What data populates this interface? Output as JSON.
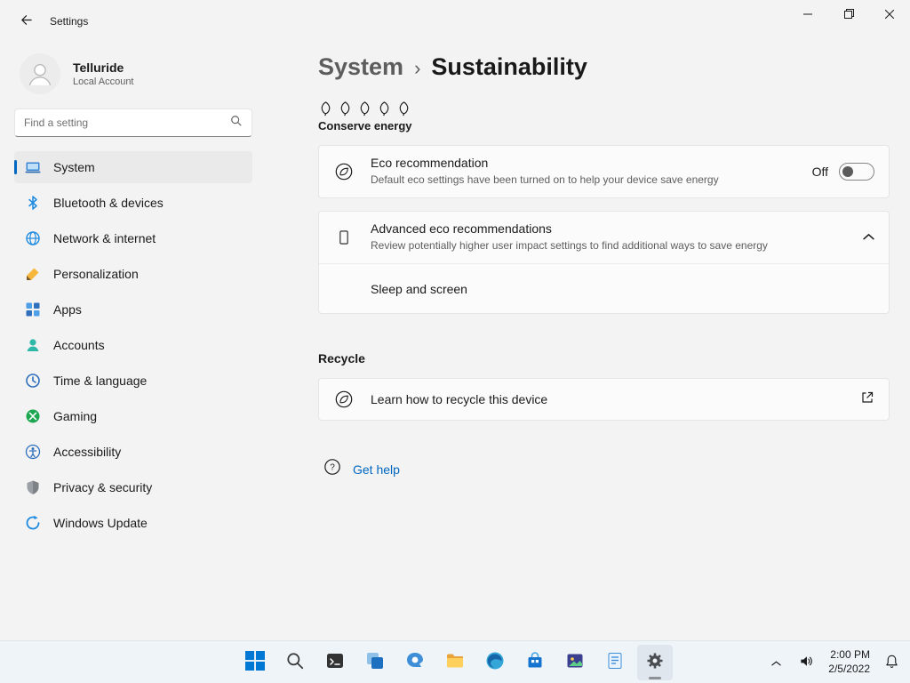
{
  "titlebar": {
    "title": "Settings"
  },
  "sidebar": {
    "user": {
      "name": "Telluride",
      "account_type": "Local Account"
    },
    "search_placeholder": "Find a setting",
    "items": [
      {
        "label": "System",
        "icon": "system-icon",
        "selected": true
      },
      {
        "label": "Bluetooth & devices",
        "icon": "bluetooth-icon",
        "selected": false
      },
      {
        "label": "Network & internet",
        "icon": "network-icon",
        "selected": false
      },
      {
        "label": "Personalization",
        "icon": "personalization-icon",
        "selected": false
      },
      {
        "label": "Apps",
        "icon": "apps-icon",
        "selected": false
      },
      {
        "label": "Accounts",
        "icon": "accounts-icon",
        "selected": false
      },
      {
        "label": "Time & language",
        "icon": "time-language-icon",
        "selected": false
      },
      {
        "label": "Gaming",
        "icon": "gaming-icon",
        "selected": false
      },
      {
        "label": "Accessibility",
        "icon": "accessibility-icon",
        "selected": false
      },
      {
        "label": "Privacy & security",
        "icon": "privacy-icon",
        "selected": false
      },
      {
        "label": "Windows Update",
        "icon": "windows-update-icon",
        "selected": false
      }
    ]
  },
  "main": {
    "breadcrumb": {
      "parent": "System",
      "separator": "›",
      "current": "Sustainability"
    },
    "conserve": {
      "label": "Conserve energy",
      "leaf_count": 5
    },
    "eco_card": {
      "title": "Eco recommendation",
      "description": "Default eco settings have been turned on to help your device save energy",
      "toggle_label": "Off",
      "toggle_state": "off"
    },
    "advanced_card": {
      "title": "Advanced eco recommendations",
      "description": "Review potentially higher user impact settings to find additional ways to save energy",
      "expanded": true
    },
    "sleep_row": {
      "label": "Sleep and screen"
    },
    "recycle": {
      "heading": "Recycle",
      "link_label": "Learn how to recycle this device"
    },
    "get_help_label": "Get help"
  },
  "taskbar": {
    "center_icons": [
      "start",
      "search",
      "terminal",
      "task-view",
      "chat",
      "file-explorer",
      "edge",
      "store",
      "photos",
      "notepad",
      "settings"
    ],
    "active_icon": "settings",
    "tray": {
      "time": "2:00 PM",
      "date": "2/5/2022"
    }
  },
  "colors": {
    "accent": "#0067c0",
    "window_bg": "#f3f3f3",
    "card_bg": "#fbfbfb",
    "taskbar_bg": "#eff4f9"
  }
}
